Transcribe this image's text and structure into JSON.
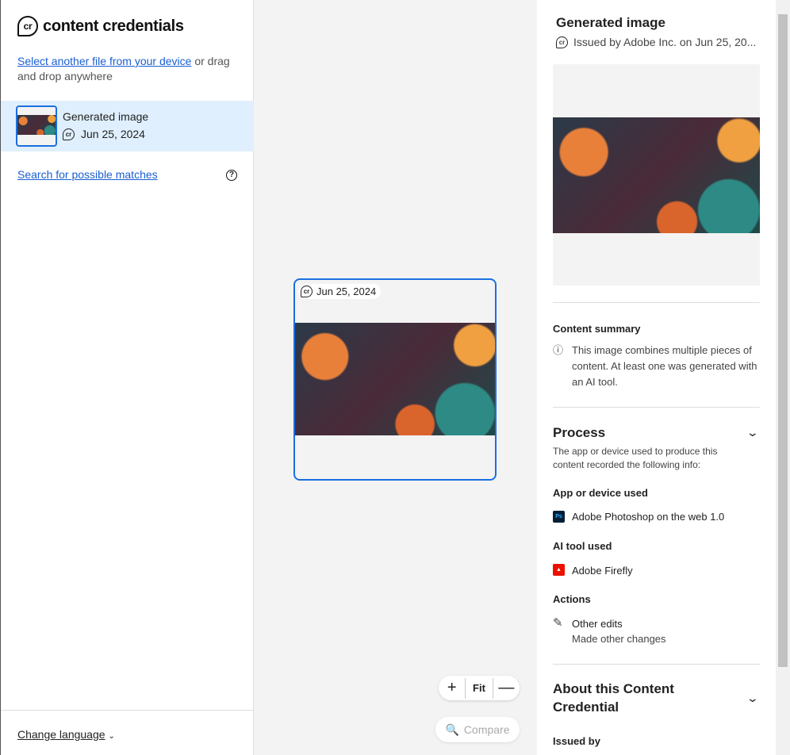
{
  "app": {
    "logo_text": "content credentials",
    "logo_mark": "cr"
  },
  "sidebar": {
    "select_link": "Select another file from your device",
    "select_rest": " or drag and drop anywhere",
    "file": {
      "name": "Generated image",
      "date": "Jun 25, 2024"
    },
    "search_link": "Search for possible matches",
    "help": "?",
    "change_language": "Change language"
  },
  "canvas": {
    "badge_date": "Jun 25, 2024",
    "zoom_in": "+",
    "fit": "Fit",
    "zoom_out": "—",
    "compare": "Compare"
  },
  "panel": {
    "title": "Generated image",
    "issued": "Issued by Adobe Inc. on Jun 25, 20...",
    "summary_heading": "Content summary",
    "summary_text": "This image combines multiple pieces of content. At least one was generated with an AI tool.",
    "process_heading": "Process",
    "process_text": "The app or device used to produce this content recorded the following info:",
    "app_heading": "App or device used",
    "app": "Adobe Photoshop on the web 1.0",
    "app_icon": "Ps",
    "ai_heading": "AI tool used",
    "ai": "Adobe Firefly",
    "actions_heading": "Actions",
    "action_title": "Other edits",
    "action_desc": "Made other changes",
    "about_heading": "About this Content Credential",
    "issued_by_heading": "Issued by"
  },
  "colors": {
    "accent": "#1a6fe0",
    "link": "#1a5fd1",
    "selected_bg": "#dfeffd"
  }
}
